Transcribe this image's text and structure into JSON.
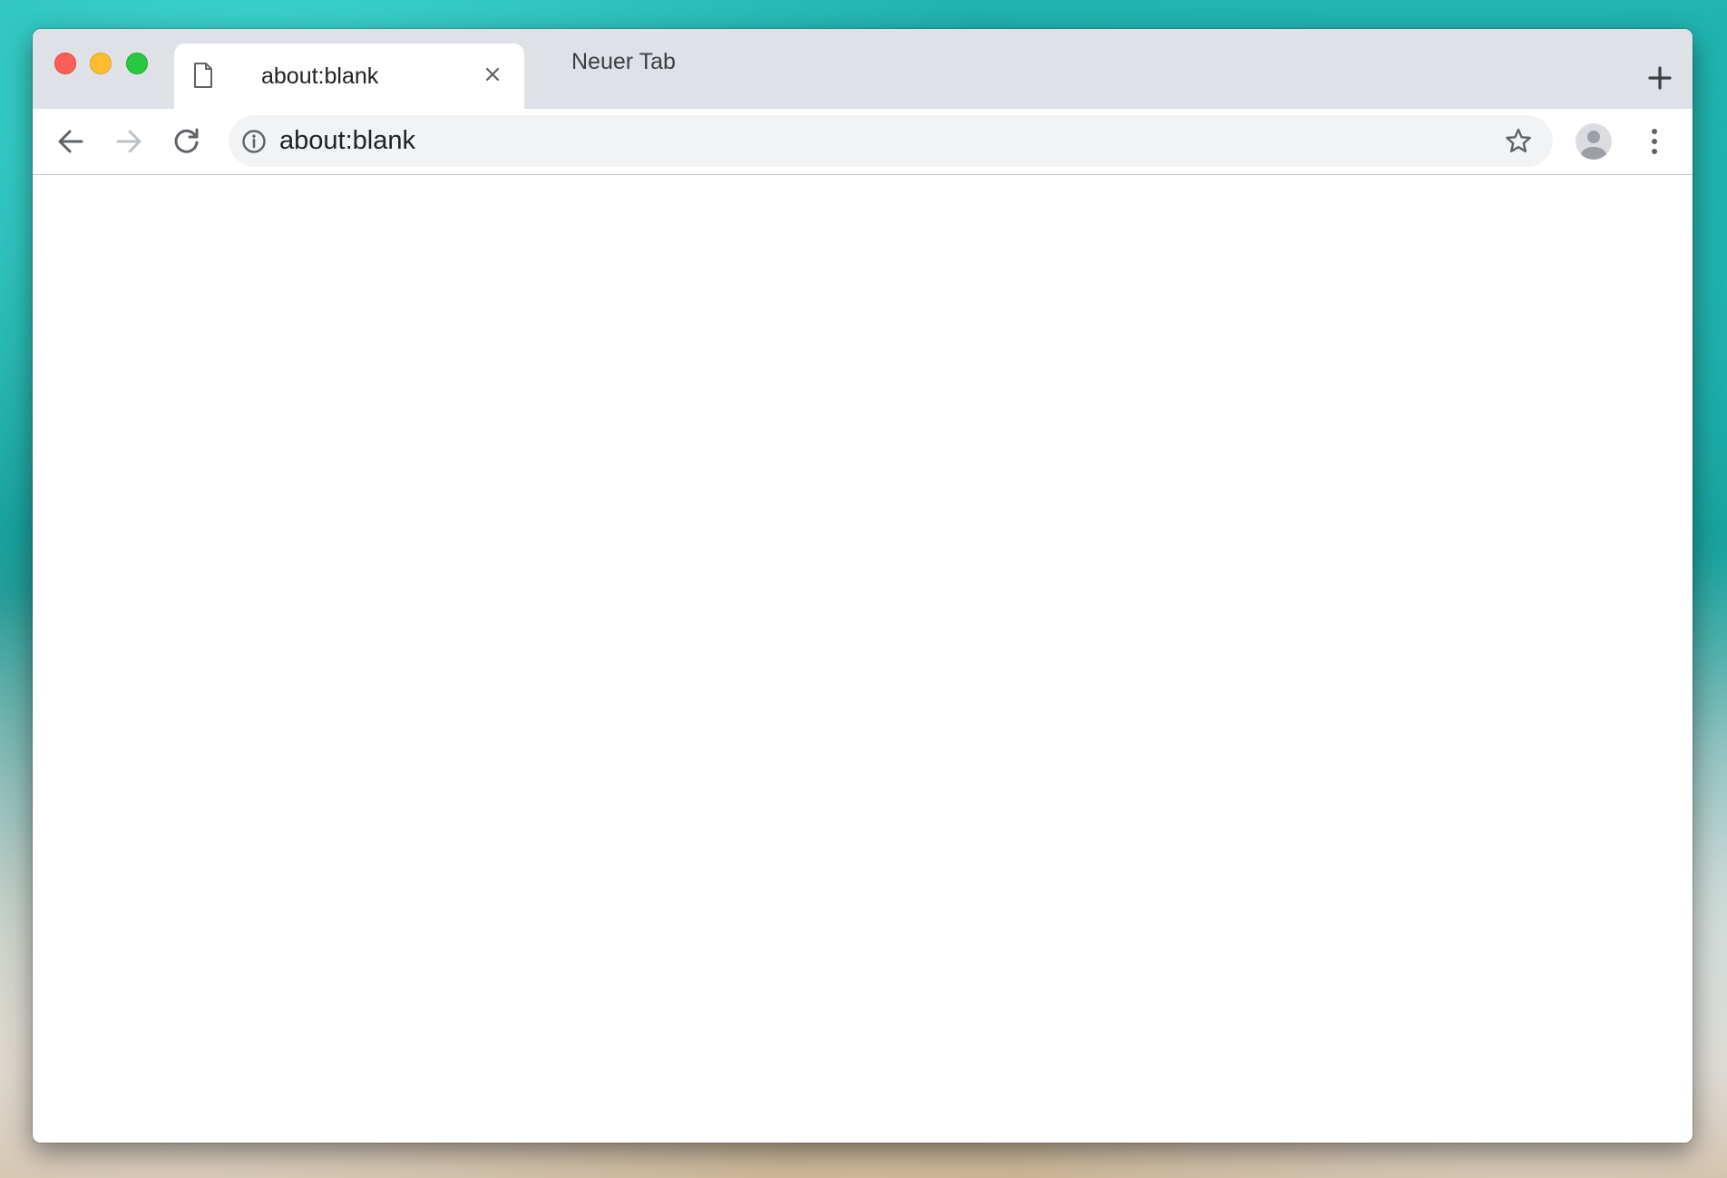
{
  "window": {
    "traffic_lights": {
      "close_color": "#fe5f57",
      "minimize_color": "#febc2e",
      "maximize_color": "#28c840"
    }
  },
  "tabs": [
    {
      "title": "about:blank",
      "active": true,
      "favicon": "page-icon"
    },
    {
      "title": "Neuer Tab",
      "active": false
    }
  ],
  "toolbar": {
    "back_icon": "arrow-left-icon",
    "forward_icon": "arrow-right-icon",
    "reload_icon": "reload-icon",
    "omnibox": {
      "value": "about:blank",
      "site_info_icon": "info-icon",
      "bookmark_icon": "star-icon"
    },
    "profile_icon": "avatar-icon",
    "menu_icon": "kebab-menu-icon"
  },
  "page": {
    "content": ""
  }
}
